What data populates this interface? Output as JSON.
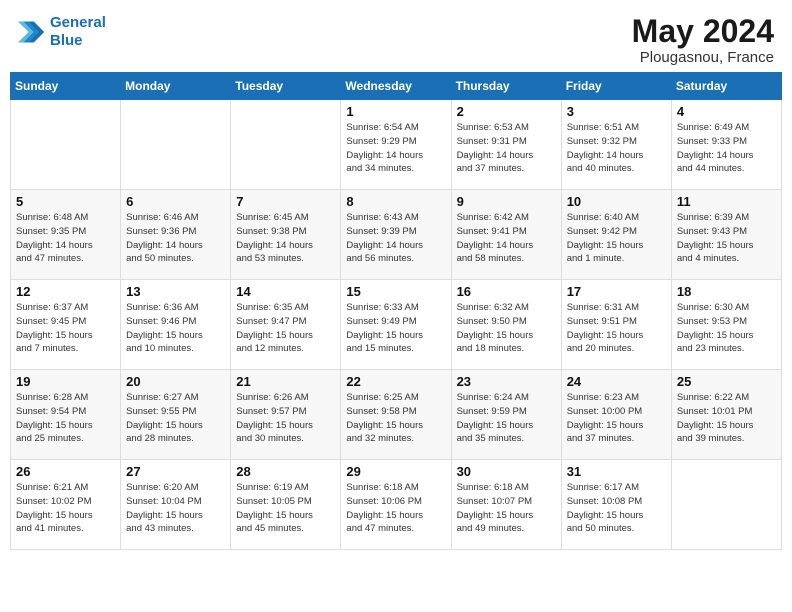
{
  "header": {
    "logo_line1": "General",
    "logo_line2": "Blue",
    "month": "May 2024",
    "location": "Plougasnou, France"
  },
  "weekdays": [
    "Sunday",
    "Monday",
    "Tuesday",
    "Wednesday",
    "Thursday",
    "Friday",
    "Saturday"
  ],
  "weeks": [
    [
      {
        "day": "",
        "info": ""
      },
      {
        "day": "",
        "info": ""
      },
      {
        "day": "",
        "info": ""
      },
      {
        "day": "1",
        "info": "Sunrise: 6:54 AM\nSunset: 9:29 PM\nDaylight: 14 hours\nand 34 minutes."
      },
      {
        "day": "2",
        "info": "Sunrise: 6:53 AM\nSunset: 9:31 PM\nDaylight: 14 hours\nand 37 minutes."
      },
      {
        "day": "3",
        "info": "Sunrise: 6:51 AM\nSunset: 9:32 PM\nDaylight: 14 hours\nand 40 minutes."
      },
      {
        "day": "4",
        "info": "Sunrise: 6:49 AM\nSunset: 9:33 PM\nDaylight: 14 hours\nand 44 minutes."
      }
    ],
    [
      {
        "day": "5",
        "info": "Sunrise: 6:48 AM\nSunset: 9:35 PM\nDaylight: 14 hours\nand 47 minutes."
      },
      {
        "day": "6",
        "info": "Sunrise: 6:46 AM\nSunset: 9:36 PM\nDaylight: 14 hours\nand 50 minutes."
      },
      {
        "day": "7",
        "info": "Sunrise: 6:45 AM\nSunset: 9:38 PM\nDaylight: 14 hours\nand 53 minutes."
      },
      {
        "day": "8",
        "info": "Sunrise: 6:43 AM\nSunset: 9:39 PM\nDaylight: 14 hours\nand 56 minutes."
      },
      {
        "day": "9",
        "info": "Sunrise: 6:42 AM\nSunset: 9:41 PM\nDaylight: 14 hours\nand 58 minutes."
      },
      {
        "day": "10",
        "info": "Sunrise: 6:40 AM\nSunset: 9:42 PM\nDaylight: 15 hours\nand 1 minute."
      },
      {
        "day": "11",
        "info": "Sunrise: 6:39 AM\nSunset: 9:43 PM\nDaylight: 15 hours\nand 4 minutes."
      }
    ],
    [
      {
        "day": "12",
        "info": "Sunrise: 6:37 AM\nSunset: 9:45 PM\nDaylight: 15 hours\nand 7 minutes."
      },
      {
        "day": "13",
        "info": "Sunrise: 6:36 AM\nSunset: 9:46 PM\nDaylight: 15 hours\nand 10 minutes."
      },
      {
        "day": "14",
        "info": "Sunrise: 6:35 AM\nSunset: 9:47 PM\nDaylight: 15 hours\nand 12 minutes."
      },
      {
        "day": "15",
        "info": "Sunrise: 6:33 AM\nSunset: 9:49 PM\nDaylight: 15 hours\nand 15 minutes."
      },
      {
        "day": "16",
        "info": "Sunrise: 6:32 AM\nSunset: 9:50 PM\nDaylight: 15 hours\nand 18 minutes."
      },
      {
        "day": "17",
        "info": "Sunrise: 6:31 AM\nSunset: 9:51 PM\nDaylight: 15 hours\nand 20 minutes."
      },
      {
        "day": "18",
        "info": "Sunrise: 6:30 AM\nSunset: 9:53 PM\nDaylight: 15 hours\nand 23 minutes."
      }
    ],
    [
      {
        "day": "19",
        "info": "Sunrise: 6:28 AM\nSunset: 9:54 PM\nDaylight: 15 hours\nand 25 minutes."
      },
      {
        "day": "20",
        "info": "Sunrise: 6:27 AM\nSunset: 9:55 PM\nDaylight: 15 hours\nand 28 minutes."
      },
      {
        "day": "21",
        "info": "Sunrise: 6:26 AM\nSunset: 9:57 PM\nDaylight: 15 hours\nand 30 minutes."
      },
      {
        "day": "22",
        "info": "Sunrise: 6:25 AM\nSunset: 9:58 PM\nDaylight: 15 hours\nand 32 minutes."
      },
      {
        "day": "23",
        "info": "Sunrise: 6:24 AM\nSunset: 9:59 PM\nDaylight: 15 hours\nand 35 minutes."
      },
      {
        "day": "24",
        "info": "Sunrise: 6:23 AM\nSunset: 10:00 PM\nDaylight: 15 hours\nand 37 minutes."
      },
      {
        "day": "25",
        "info": "Sunrise: 6:22 AM\nSunset: 10:01 PM\nDaylight: 15 hours\nand 39 minutes."
      }
    ],
    [
      {
        "day": "26",
        "info": "Sunrise: 6:21 AM\nSunset: 10:02 PM\nDaylight: 15 hours\nand 41 minutes."
      },
      {
        "day": "27",
        "info": "Sunrise: 6:20 AM\nSunset: 10:04 PM\nDaylight: 15 hours\nand 43 minutes."
      },
      {
        "day": "28",
        "info": "Sunrise: 6:19 AM\nSunset: 10:05 PM\nDaylight: 15 hours\nand 45 minutes."
      },
      {
        "day": "29",
        "info": "Sunrise: 6:18 AM\nSunset: 10:06 PM\nDaylight: 15 hours\nand 47 minutes."
      },
      {
        "day": "30",
        "info": "Sunrise: 6:18 AM\nSunset: 10:07 PM\nDaylight: 15 hours\nand 49 minutes."
      },
      {
        "day": "31",
        "info": "Sunrise: 6:17 AM\nSunset: 10:08 PM\nDaylight: 15 hours\nand 50 minutes."
      },
      {
        "day": "",
        "info": ""
      }
    ]
  ]
}
